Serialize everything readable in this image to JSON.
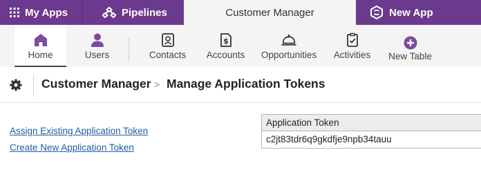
{
  "top_tabs": {
    "my_apps": "My Apps",
    "pipelines": "Pipelines",
    "active_app": "Customer Manager",
    "new_app": "New App"
  },
  "nav": {
    "items": [
      {
        "label": "Home",
        "icon": "home-icon",
        "active": true
      },
      {
        "label": "Users",
        "icon": "user-icon"
      },
      {
        "label": "Contacts",
        "icon": "contact-card-icon"
      },
      {
        "label": "Accounts",
        "icon": "dollar-document-icon"
      },
      {
        "label": "Opportunities",
        "icon": "service-bell-icon"
      },
      {
        "label": "Activities",
        "icon": "clipboard-check-icon"
      },
      {
        "label": "New Table",
        "icon": "plus-circle-icon"
      }
    ]
  },
  "breadcrumb": {
    "app": "Customer Manager",
    "separator": ">",
    "page": "Manage Application Tokens"
  },
  "links": {
    "assign": "Assign Existing Application Token",
    "create": "Create New Application Token"
  },
  "token_table": {
    "header": "Application Token",
    "rows": [
      "c2jt83tdr6q9gkdfje9npb34tauu"
    ]
  },
  "colors": {
    "brand_purple": "#6b3a8e",
    "icon_purple": "#7b4ba0",
    "link_blue": "#1f5d9e"
  }
}
